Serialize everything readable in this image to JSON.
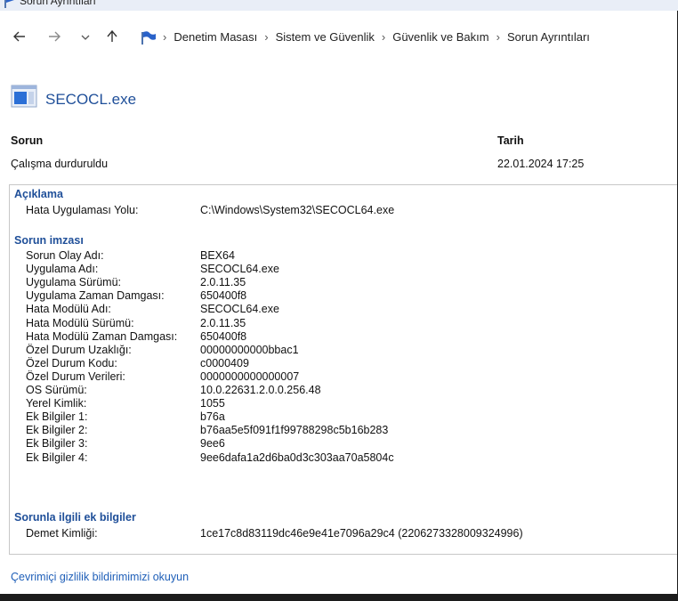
{
  "window": {
    "title": "Sorun Ayrıntıları"
  },
  "breadcrumb": [
    "Denetim Masası",
    "Sistem ve Güvenlik",
    "Güvenlik ve Bakım",
    "Sorun Ayrıntıları"
  ],
  "app": {
    "name": "SECOCL.exe"
  },
  "summary": {
    "problem_label": "Sorun",
    "problem_value": "Çalışma durduruldu",
    "date_label": "Tarih",
    "date_value": "22.01.2024 17:25"
  },
  "description": {
    "title": "Açıklama",
    "rows": [
      {
        "label": "Hata Uygulaması Yolu:",
        "value": "C:\\Windows\\System32\\SECOCL64.exe"
      }
    ]
  },
  "signature": {
    "title": "Sorun imzası",
    "rows": [
      {
        "label": "Sorun Olay Adı:",
        "value": "BEX64"
      },
      {
        "label": "Uygulama Adı:",
        "value": "SECOCL64.exe"
      },
      {
        "label": "Uygulama Sürümü:",
        "value": "2.0.11.35"
      },
      {
        "label": "Uygulama Zaman Damgası:",
        "value": "650400f8"
      },
      {
        "label": "Hata Modülü Adı:",
        "value": "SECOCL64.exe"
      },
      {
        "label": "Hata Modülü Sürümü:",
        "value": "2.0.11.35"
      },
      {
        "label": "Hata Modülü Zaman Damgası:",
        "value": "650400f8"
      },
      {
        "label": "Özel Durum Uzaklığı:",
        "value": "00000000000bbac1"
      },
      {
        "label": "Özel Durum Kodu:",
        "value": "c0000409"
      },
      {
        "label": "Özel Durum Verileri:",
        "value": "0000000000000007"
      },
      {
        "label": "OS Sürümü:",
        "value": "10.0.22631.2.0.0.256.48"
      },
      {
        "label": "Yerel Kimlik:",
        "value": "1055"
      },
      {
        "label": "Ek Bilgiler 1:",
        "value": "b76a"
      },
      {
        "label": "Ek Bilgiler 2:",
        "value": "b76aa5e5f091f1f99788298c5b16b283"
      },
      {
        "label": "Ek Bilgiler 3:",
        "value": "9ee6"
      },
      {
        "label": "Ek Bilgiler 4:",
        "value": "9ee6dafa1a2d6ba0d3c303aa70a5804c"
      }
    ]
  },
  "extra": {
    "title": "Sorunla ilgili ek bilgiler",
    "rows": [
      {
        "label": "Demet Kimliği:",
        "value": "1ce17c8d83119dc46e9e41e7096a29c4 (2206273328009324996)"
      }
    ]
  },
  "footer": {
    "privacy_link": "Çevrimiçi gizlilik bildirimimizi okuyun"
  },
  "colors": {
    "accent": "#1f4f99",
    "link": "#1f5fb8"
  },
  "icons": [
    "flag-icon",
    "back-arrow-icon",
    "forward-arrow-icon",
    "chevron-down-icon",
    "up-arrow-icon",
    "app-window-icon"
  ]
}
